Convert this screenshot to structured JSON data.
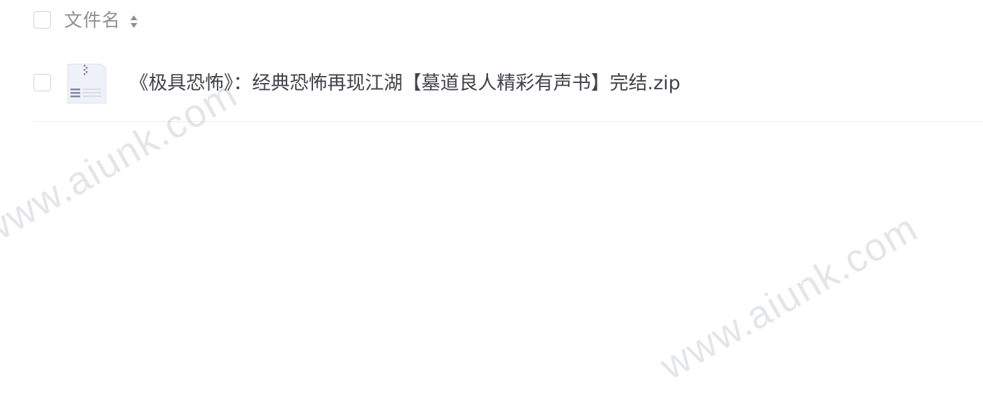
{
  "file_list": {
    "header": {
      "column_label": "文件名",
      "sort_icon": "sort-toggle-icon"
    },
    "files": [
      {
        "name": "《极具恐怖》：经典恐怖再现江湖【墓道良人精彩有声书】完结.zip",
        "icon": "zip-file-icon"
      }
    ]
  },
  "watermark": {
    "text": "www.aiunk.com"
  },
  "colors": {
    "header_text": "#8e9095",
    "file_text": "#404349",
    "divider": "#eceef1",
    "checkbox_border": "#cfd2d6"
  }
}
